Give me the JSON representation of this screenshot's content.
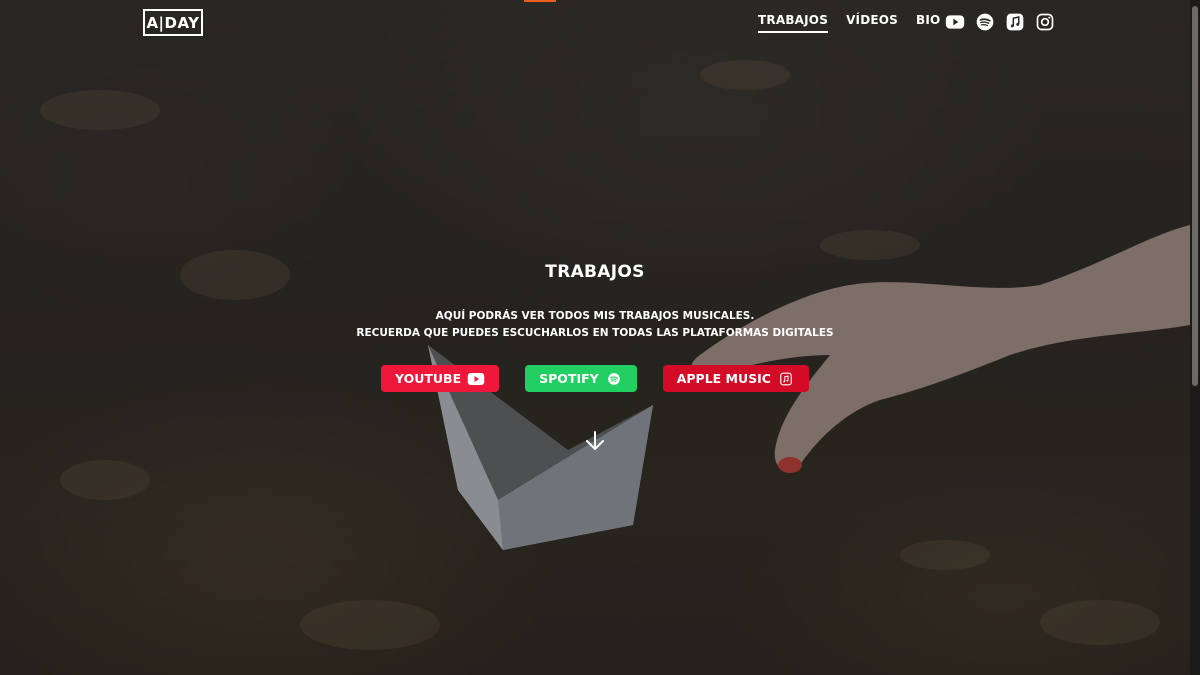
{
  "header": {
    "logo_text": "A|DAY",
    "nav": [
      {
        "label": "TRABAJOS",
        "active": true
      },
      {
        "label": "VÍDEOS",
        "active": false
      },
      {
        "label": "BIO",
        "active": false
      }
    ],
    "social_icons": [
      "youtube-icon",
      "spotify-icon",
      "apple-music-icon",
      "instagram-icon"
    ]
  },
  "hero": {
    "title": "TRABAJOS",
    "desc_line1": "AQUÍ PODRÁS VER TODOS MIS TRABAJOS MUSICALES.",
    "desc_line2": "RECUERDA QUE PUEDES ESCUCHARLOS EN TODAS LAS PLATAFORMAS DIGITALES",
    "buttons": [
      {
        "label": "YOUTUBE",
        "icon": "youtube-icon",
        "color": "#f0183a"
      },
      {
        "label": "SPOTIFY",
        "icon": "spotify-icon",
        "color": "#22cf63"
      },
      {
        "label": "APPLE MUSIC",
        "icon": "apple-music-icon",
        "color": "#d40b26"
      }
    ],
    "scroll_icon": "arrow-down-icon"
  },
  "colors": {
    "accent": "#e8601c",
    "youtube": "#f0183a",
    "spotify": "#22cf63",
    "apple_music": "#d40b26"
  }
}
